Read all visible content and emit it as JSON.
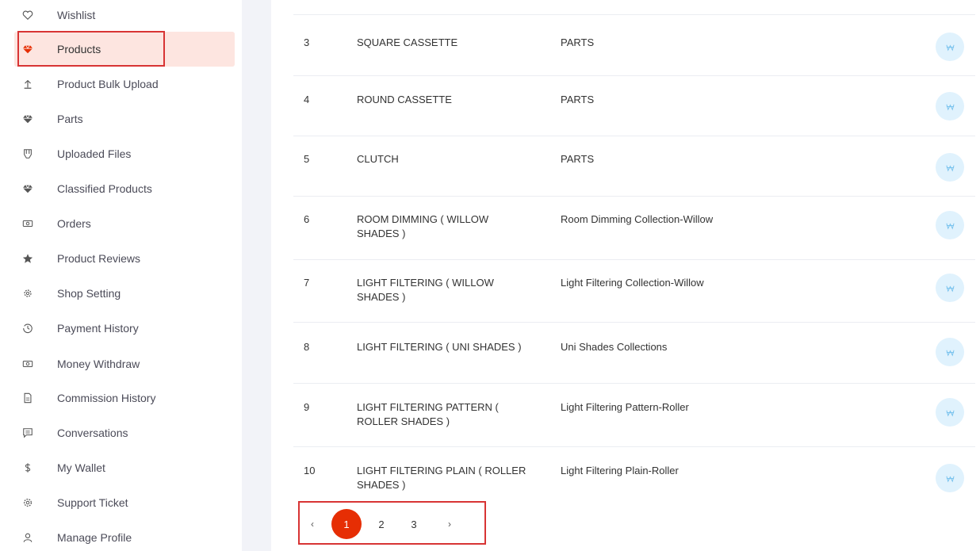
{
  "sidebar": {
    "items": [
      {
        "label": "Wishlist",
        "icon": "heart-icon"
      },
      {
        "label": "Products",
        "icon": "diamond-icon",
        "active": true
      },
      {
        "label": "Product Bulk Upload",
        "icon": "upload-icon"
      },
      {
        "label": "Parts",
        "icon": "diamond-icon"
      },
      {
        "label": "Uploaded Files",
        "icon": "folder-icon"
      },
      {
        "label": "Classified Products",
        "icon": "diamond-icon"
      },
      {
        "label": "Orders",
        "icon": "money-icon"
      },
      {
        "label": "Product Reviews",
        "icon": "star-icon"
      },
      {
        "label": "Shop Setting",
        "icon": "gear-icon"
      },
      {
        "label": "Payment History",
        "icon": "history-icon"
      },
      {
        "label": "Money Withdraw",
        "icon": "money-icon"
      },
      {
        "label": "Commission History",
        "icon": "file-icon"
      },
      {
        "label": "Conversations",
        "icon": "chat-icon"
      },
      {
        "label": "My Wallet",
        "icon": "dollar-icon"
      },
      {
        "label": "Support Ticket",
        "icon": "support-icon"
      },
      {
        "label": "Manage Profile",
        "icon": "user-icon"
      }
    ]
  },
  "table": {
    "rows": [
      {
        "num": "3",
        "name": "SQUARE CASSETTE",
        "category": "PARTS"
      },
      {
        "num": "4",
        "name": "ROUND CASSETTE",
        "category": "PARTS"
      },
      {
        "num": "5",
        "name": "CLUTCH",
        "category": "PARTS"
      },
      {
        "num": "6",
        "name": "ROOM DIMMING ( WILLOW SHADES )",
        "category": "Room Dimming Collection-Willow"
      },
      {
        "num": "7",
        "name": "LIGHT FILTERING ( WILLOW SHADES )",
        "category": "Light Filtering Collection-Willow"
      },
      {
        "num": "8",
        "name": "LIGHT FILTERING ( UNI SHADES )",
        "category": "Uni Shades Collections"
      },
      {
        "num": "9",
        "name": "LIGHT FILTERING PATTERN ( ROLLER SHADES )",
        "category": "Light Filtering Pattern-Roller"
      },
      {
        "num": "10",
        "name": "LIGHT FILTERING PLAIN ( ROLLER SHADES )",
        "category": "Light Filtering Plain-Roller"
      }
    ]
  },
  "pagination": {
    "prev": "‹",
    "pages": [
      "1",
      "2",
      "3"
    ],
    "current": "1",
    "next": "›"
  },
  "colors": {
    "accent": "#e62e04",
    "active_bg": "#fde5e0",
    "highlight": "#d83434",
    "action_bg": "#e0f2fd"
  }
}
